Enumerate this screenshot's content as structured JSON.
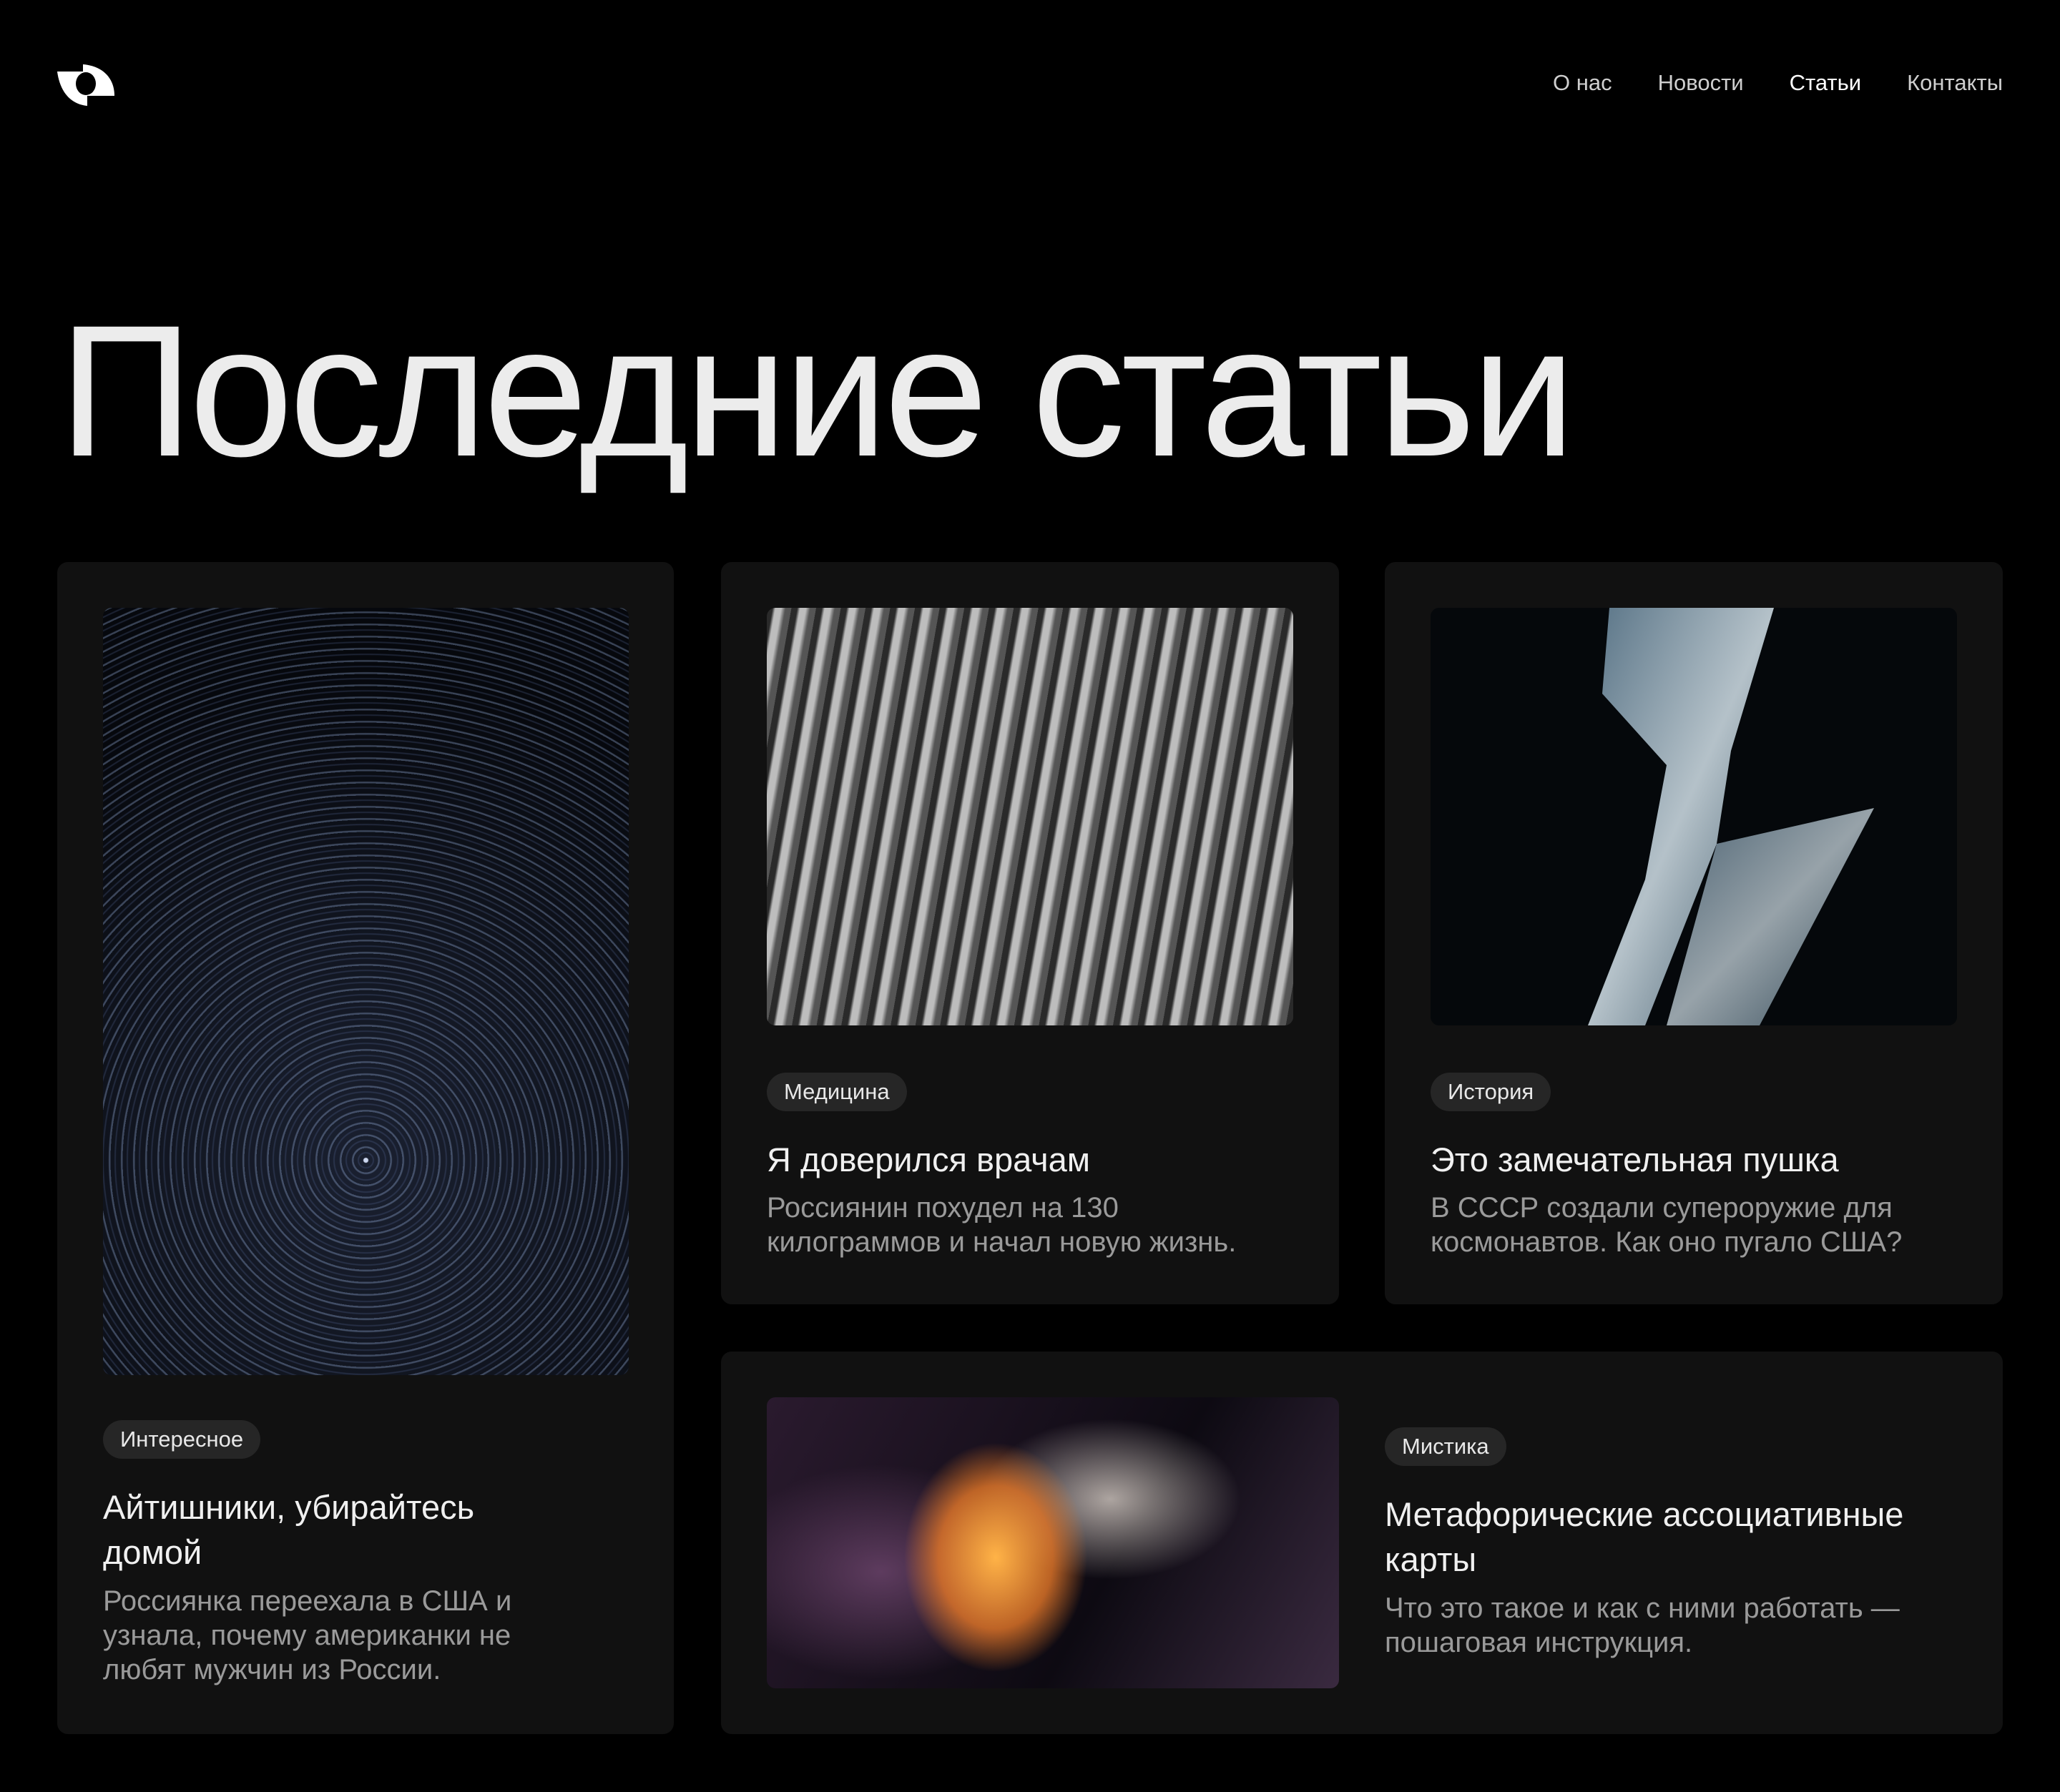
{
  "header": {
    "logo": "eye-logo",
    "nav": [
      {
        "label": "О нас",
        "active": false
      },
      {
        "label": "Новости",
        "active": false
      },
      {
        "label": "Статьи",
        "active": true
      },
      {
        "label": "Контакты",
        "active": false
      }
    ]
  },
  "page_title": "Последние статьи",
  "articles": [
    {
      "tag": "Интересное",
      "title": "Айтишники, убирайтесь домой",
      "description": "Россиянка переехала в США и узнала, почему американки не любят мужчин из России.",
      "image": "star-trails"
    },
    {
      "tag": "Медицина",
      "title": "Я доверился врачам",
      "description": "Россиянин похудел на 130 килограммов и начал новую жизнь.",
      "image": "wavy-lines-texture"
    },
    {
      "tag": "История",
      "title": "Это замечательная пушка",
      "description": "В СССР создали супероружие для космонавтов. Как оно пугало США?",
      "image": "ice-fragment"
    },
    {
      "tag": "Мистика",
      "title": "Метафорические ассоциативные карты",
      "description": "Что это такое и как с ними работать — пошаговая инструкция.",
      "image": "ink-swirl"
    }
  ]
}
